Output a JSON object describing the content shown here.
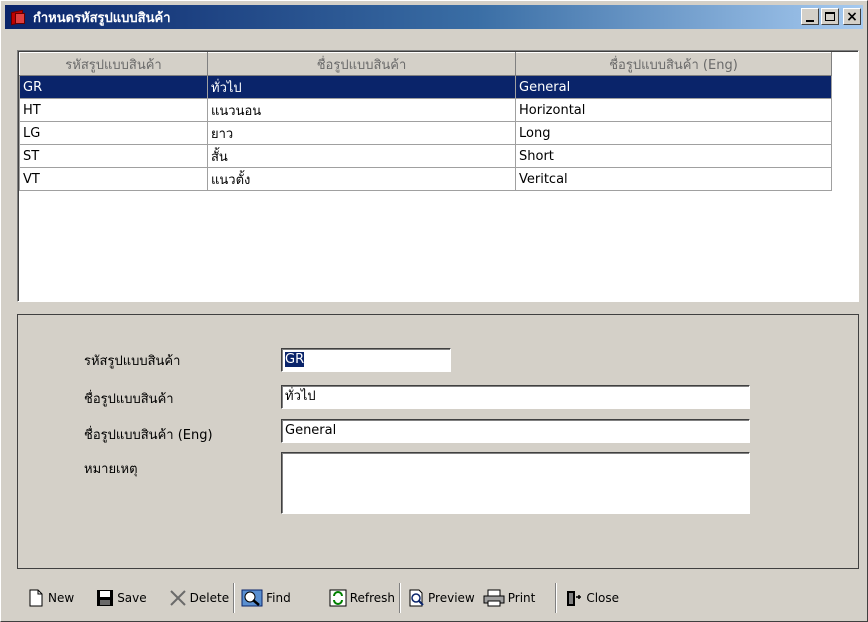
{
  "window": {
    "title": "กำหนดรหัสรูปแบบสินค้า"
  },
  "grid": {
    "columns": [
      "รหัสรูปแบบสินค้า",
      "ชื่อรูปแบบสินค้า",
      "ชื่อรูปแบบสินค้า (Eng)"
    ],
    "rows": [
      {
        "code": "GR",
        "name": "ทั่วไป",
        "name_eng": "General"
      },
      {
        "code": "HT",
        "name": "แนวนอน",
        "name_eng": "Horizontal"
      },
      {
        "code": "LG",
        "name": "ยาว",
        "name_eng": "Long"
      },
      {
        "code": "ST",
        "name": "สั้น",
        "name_eng": "Short"
      },
      {
        "code": "VT",
        "name": "แนวตั้ง",
        "name_eng": "Veritcal"
      }
    ],
    "selected_index": 0
  },
  "form": {
    "code_label": "รหัสรูปแบบสินค้า",
    "code_value": "GR",
    "name_label": "ชื่อรูปแบบสินค้า",
    "name_value": "ทั่วไป",
    "name_eng_label": "ชื่อรูปแบบสินค้า (Eng)",
    "name_eng_value": "General",
    "remark_label": "หมายเหตุ",
    "remark_value": ""
  },
  "toolbar": {
    "new_label": "New",
    "save_label": "Save",
    "delete_label": "Delete",
    "find_label": "Find",
    "refresh_label": "Refresh",
    "preview_label": "Preview",
    "print_label": "Print",
    "close_label": "Close"
  },
  "colors": {
    "title_start": "#0a246a",
    "title_end": "#a6caf0",
    "selection": "#0a246a",
    "face": "#d4d0c8"
  }
}
